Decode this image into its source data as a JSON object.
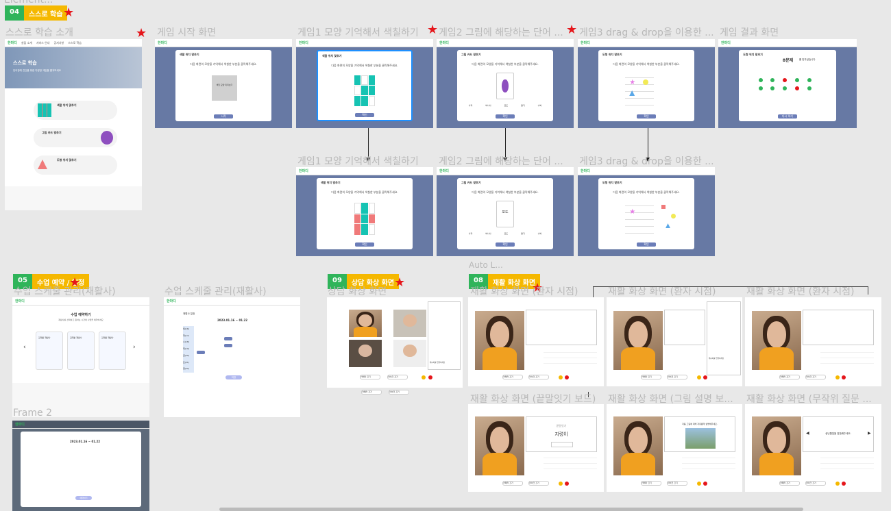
{
  "top_cut_label": "Element...",
  "sections": {
    "s04": {
      "num": "04",
      "title": "스스로 학습"
    },
    "s05": {
      "num": "05",
      "title": "수업 예약 / 일정"
    },
    "s09": {
      "num": "09",
      "title": "상담 화상 화면"
    },
    "s08": {
      "num": "08",
      "title": "재활 화상 화면"
    }
  },
  "frame_labels": {
    "intro": "스스로 학습 소개",
    "game_start": "게임 시작 화면",
    "game1": "게임1 모양 기억해서 색칠하기",
    "game2": "게임2 그림에 해당하는 단어 ...",
    "game3": "게임3 drag & drop을 이용한 ...",
    "game_result": "게임 결과 화면",
    "game1_b": "게임1 모양 기억해서 색칠하기",
    "game2_b": "게임2 그림에 해당하는 단어 ...",
    "game3_b": "게임3 drag & drop을 이용한 ...",
    "schedule_mgmt": "수업 스케줄 관리(재활사)",
    "schedule_mgmt2": "수업 스케줄 관리(재활사)",
    "consult": "상담 화상 화면",
    "auto_layout": "Auto L...",
    "rehab1": "재활 화상 화면 (환자 시점)",
    "rehab2": "재활 화상 화면 (환자 시점)",
    "rehab3": "재활 화상 화면 (환자 시점)",
    "rehab_word": "재활 화상 화면 (끝말잇기 보드)",
    "rehab_pic": "재활 화상 화면 (그림 설명 보...",
    "rehab_random": "재활 화상 화면 (무작위 질문 ...",
    "frame2": "Frame 2"
  },
  "app": {
    "logo": "한마디",
    "nav": [
      "설립 소개",
      "서비스 안내",
      "공지사항",
      "스스로 학습",
      "수업 예약"
    ],
    "login": "로그인 · 회원가입"
  },
  "intro": {
    "hero_title": "스스로 학습",
    "hero_sub": "언어장애 진단을 위한 다양한 게임을 즐겨보세요",
    "items": [
      "색깔 위치 맞추기",
      "그림 카드 맞추기",
      "도형 위치 맞추기"
    ],
    "levels": [
      "초급",
      "중급",
      "고급"
    ]
  },
  "games": {
    "color_title": "색깔 위치 맞추기",
    "card_title": "그림 카드 맞추기",
    "shape_title": "도형 위치 맞추기",
    "start_btn": "시작",
    "confirm_btn": "확인",
    "hint": "다음 화면의 모양을 기억해서 색칠한 부분을 클릭해주세요.",
    "memo_box": "색칠 모양 미리보기",
    "card_word": "포도",
    "result_title": "8문제",
    "result_sub": "를 맞추셨습니다",
    "result_btn": "다시 하기",
    "options": [
      "사과",
      "바나나",
      "포도",
      "딸기",
      "수박"
    ]
  },
  "schedule": {
    "title": "수업 예약하기",
    "sub": "재활사를 선택하고 원하는 시간에 수업을 예약하세요",
    "therapists": [
      "김재활 재활사",
      "김재활 재활사",
      "김재활 재활사"
    ],
    "week": "2023.01.16 ~ 01.22",
    "days": [
      "월(16)",
      "화(17)",
      "수(18)",
      "목(19)",
      "금(20)",
      "토(21)",
      "일(22)"
    ],
    "save": "저장",
    "week_title": "재활사 일정",
    "reserve_btn": "예약하기"
  },
  "call": {
    "camera": "카메라 끄기",
    "mic": "마이크 끄기",
    "chat_title": "채팅",
    "chat_input": "메시지를 입력하세요",
    "word_board_top": "끝말잇기",
    "word_board_word": "지렁이",
    "pic_prompt": "다음 그림에 대해 자유롭게 설명해주세요.",
    "random_prompt": "생년월일을 말씀해주세요."
  },
  "colors": {
    "green": "#2fb45a",
    "yellow": "#f5b800",
    "slate": "#6779a4",
    "teal": "#16c3b3",
    "pink": "#f07a7a",
    "star": "#e5161b"
  }
}
